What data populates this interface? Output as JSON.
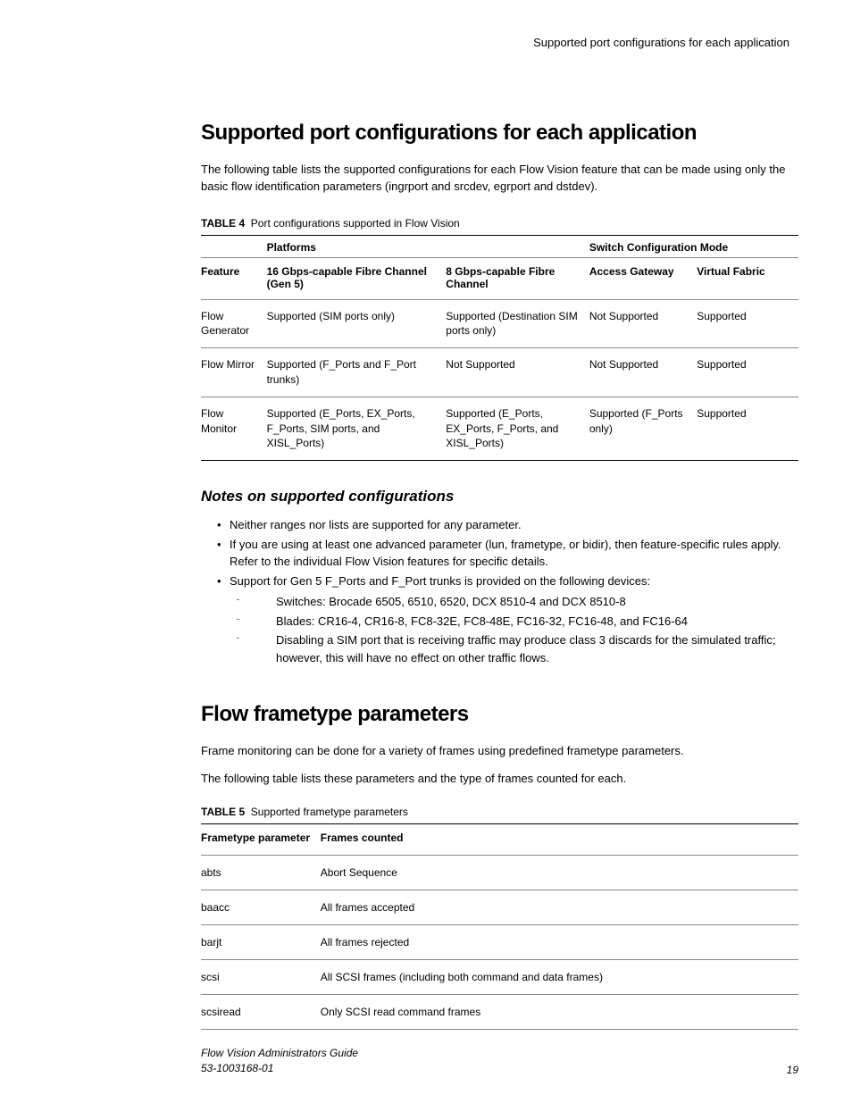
{
  "header": {
    "running_title": "Supported port configurations for each application"
  },
  "section1": {
    "title": "Supported port configurations for each application",
    "intro": "The following table lists the supported configurations for each Flow Vision feature that can be made using only the basic flow identification parameters (ingrport and srcdev, egrport and dstdev).",
    "table_label_strong": "TABLE 4",
    "table_label_text": "Port configurations supported in Flow Vision",
    "table": {
      "group_headers": {
        "g1": "Platforms",
        "g2": "Switch Configuration Mode"
      },
      "sub_headers": {
        "h0": "Feature",
        "h1": "16 Gbps-capable Fibre Channel (Gen 5)",
        "h2": "8 Gbps-capable Fibre Channel",
        "h3": "Access Gateway",
        "h4": "Virtual Fabric"
      },
      "rows": [
        {
          "c0": "Flow Generator",
          "c1": "Supported (SIM ports only)",
          "c2": "Supported (Destination SIM ports only)",
          "c3": "Not Supported",
          "c4": "Supported"
        },
        {
          "c0": "Flow Mirror",
          "c1": "Supported (F_Ports and F_Port trunks)",
          "c2": "Not Supported",
          "c3": "Not Supported",
          "c4": "Supported"
        },
        {
          "c0": "Flow Monitor",
          "c1": "Supported (E_Ports, EX_Ports, F_Ports, SIM ports, and XISL_Ports)",
          "c2": "Supported (E_Ports, EX_Ports, F_Ports, and XISL_Ports)",
          "c3": "Supported (F_Ports only)",
          "c4": "Supported"
        }
      ]
    },
    "notes_title": "Notes on supported configurations",
    "notes": [
      "Neither ranges nor lists are supported for any parameter.",
      "If you are using at least one advanced parameter (lun, frametype, or bidir), then feature-specific rules apply. Refer to the individual Flow Vision features for specific details.",
      "Support for Gen 5 F_Ports and F_Port trunks is provided on the following devices:"
    ],
    "sub_notes": [
      "Switches: Brocade 6505, 6510, 6520, DCX 8510-4 and DCX 8510-8",
      "Blades: CR16-4, CR16-8, FC8-32E, FC8-48E, FC16-32, FC16-48, and FC16-64",
      "Disabling a SIM port that is receiving traffic may produce class 3 discards for the simulated traffic; however, this will have no effect on other traffic flows."
    ]
  },
  "section2": {
    "title": "Flow frametype parameters",
    "para1": "Frame monitoring can be done for a variety of frames using predefined frametype parameters.",
    "para2": "The following table lists these parameters and the type of frames counted for each.",
    "table_label_strong": "TABLE 5",
    "table_label_text": "Supported frametype parameters",
    "table": {
      "headers": {
        "h0": "Frametype parameter",
        "h1": "Frames counted"
      },
      "rows": [
        {
          "c0": "abts",
          "c1": "Abort Sequence"
        },
        {
          "c0": "baacc",
          "c1": "All frames accepted"
        },
        {
          "c0": "barjt",
          "c1": "All frames rejected"
        },
        {
          "c0": "scsi",
          "c1": "All SCSI frames (including both command and data frames)"
        },
        {
          "c0": "scsiread",
          "c1": "Only SCSI read command frames"
        }
      ]
    }
  },
  "footer": {
    "guide": "Flow Vision Administrators Guide",
    "docnum": "53-1003168-01",
    "page": "19"
  }
}
